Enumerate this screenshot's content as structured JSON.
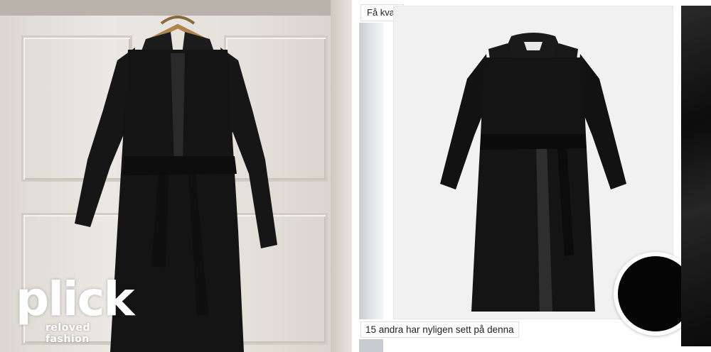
{
  "brand": {
    "logo_text": "plick",
    "tagline": "reloved fashion"
  },
  "right_panel": {
    "stock_badge": "Få kvar",
    "views_caption": "15 andra har nyligen sett på denna"
  },
  "product": {
    "color_swatch": "#050505"
  },
  "colors": {
    "coat": "#141414",
    "card_background": "#f1f1f1"
  }
}
